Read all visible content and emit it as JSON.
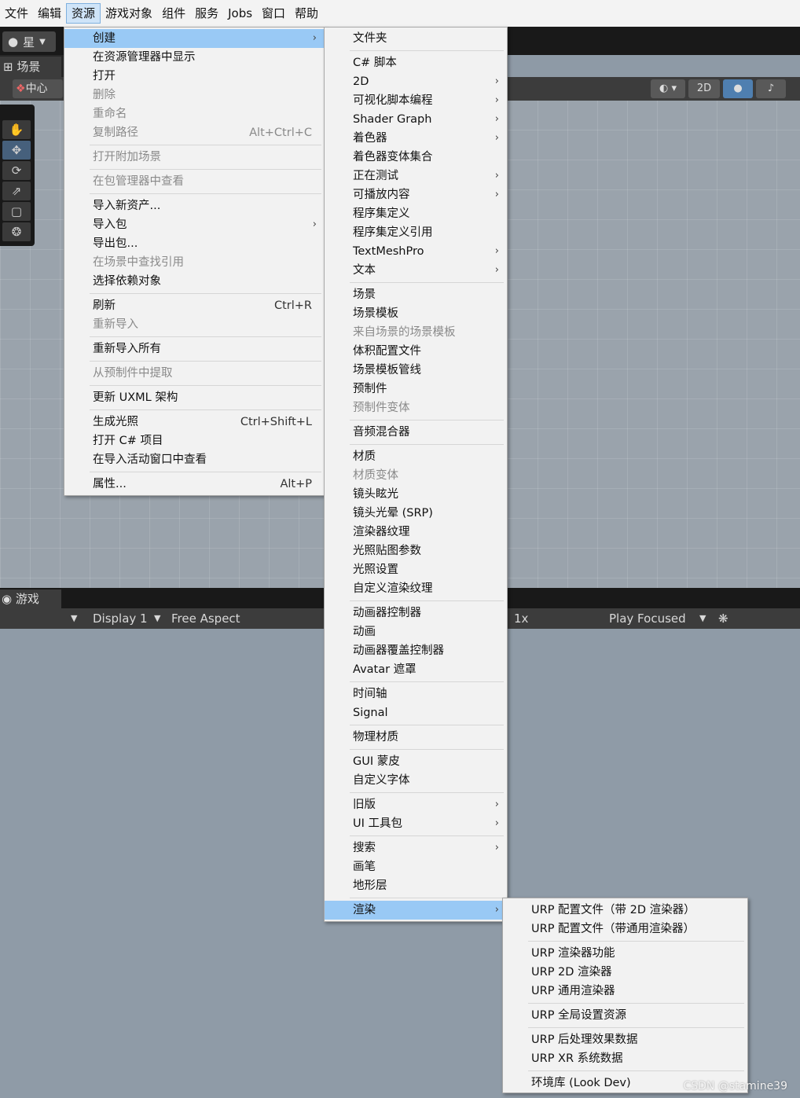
{
  "menubar": {
    "items": [
      "文件",
      "编辑",
      "资源",
      "游戏对象",
      "组件",
      "服务",
      "Jobs",
      "窗口",
      "帮助"
    ]
  },
  "toolbar": {
    "account_label": "星"
  },
  "scene": {
    "tab_label": "场景",
    "pivot_label": "中心",
    "btn_2d": "2D"
  },
  "game": {
    "tab_label": "游戏",
    "display_label": "Display 1",
    "aspect_label": "Free Aspect",
    "scale_label": "1x",
    "play_mode_label": "Play Focused"
  },
  "assets_menu": {
    "create": "创建",
    "show_in_explorer": "在资源管理器中显示",
    "open": "打开",
    "delete": "删除",
    "rename": "重命名",
    "copy_path": "复制路径",
    "copy_path_sc": "Alt+Ctrl+C",
    "open_scene_additive": "打开附加场景",
    "view_in_package_manager": "在包管理器中查看",
    "import_new_asset": "导入新资产...",
    "import_package": "导入包",
    "export_package": "导出包...",
    "find_references": "在场景中查找引用",
    "select_dependencies": "选择依赖对象",
    "refresh": "刷新",
    "refresh_sc": "Ctrl+R",
    "reimport": "重新导入",
    "reimport_all": "重新导入所有",
    "extract_from_prefab": "从预制件中提取",
    "update_uxml_schema": "更新 UXML 架构",
    "generate_lighting": "生成光照",
    "generate_lighting_sc": "Ctrl+Shift+L",
    "open_csharp_project": "打开 C# 项目",
    "view_in_import_window": "在导入活动窗口中查看",
    "properties": "属性...",
    "properties_sc": "Alt+P"
  },
  "create_menu": {
    "folder": "文件夹",
    "csharp_script": "C# 脚本",
    "item_2d": "2D",
    "visual_scripting": "可视化脚本编程",
    "shader_graph": "Shader Graph",
    "shader": "着色器",
    "shader_variant_collection": "着色器变体集合",
    "testing": "正在测试",
    "playables": "可播放内容",
    "assembly_definition": "程序集定义",
    "assembly_definition_reference": "程序集定义引用",
    "textmeshpro": "TextMeshPro",
    "text": "文本",
    "scene": "场景",
    "scene_template": "场景模板",
    "scene_template_from_scene": "来自场景的场景模板",
    "volume_profile": "体积配置文件",
    "scene_template_pipeline": "场景模板管线",
    "prefab": "预制件",
    "prefab_variant": "预制件变体",
    "audio_mixer": "音频混合器",
    "material": "材质",
    "material_variant": "材质变体",
    "lens_flare": "镜头眩光",
    "lens_flare_srp": "镜头光晕 (SRP)",
    "render_texture": "渲染器纹理",
    "lightmap_parameters": "光照贴图参数",
    "lighting_settings": "光照设置",
    "custom_render_texture": "自定义渲染纹理",
    "animator_controller": "动画器控制器",
    "animation": "动画",
    "animator_override_controller": "动画器覆盖控制器",
    "avatar_mask": "Avatar 遮罩",
    "timeline": "时间轴",
    "signal": "Signal",
    "physic_material": "物理材质",
    "gui_skin": "GUI 蒙皮",
    "custom_font": "自定义字体",
    "legacy": "旧版",
    "ui_toolkit": "UI 工具包",
    "search": "搜索",
    "brush": "画笔",
    "terrain_layer": "地形层",
    "rendering": "渲染"
  },
  "render_menu": {
    "urp_asset_2d": "URP 配置文件（带 2D 渲染器）",
    "urp_asset_universal": "URP 配置文件（带通用渲染器）",
    "urp_renderer_feature": "URP 渲染器功能",
    "urp_2d_renderer": "URP 2D 渲染器",
    "urp_universal_renderer": "URP 通用渲染器",
    "urp_global_settings": "URP 全局设置资源",
    "urp_post_process_data": "URP 后处理效果数据",
    "urp_xr_system_data": "URP XR 系统数据",
    "look_dev": "环境库 (Look Dev)"
  },
  "watermark": "CSDN @stamine39"
}
